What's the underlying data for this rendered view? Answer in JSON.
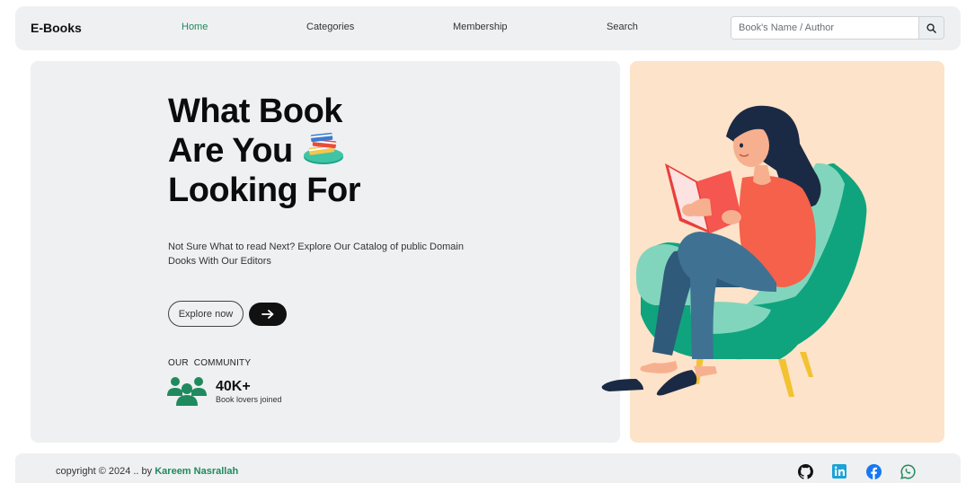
{
  "navbar": {
    "brand": "E-Books",
    "links": [
      "Home",
      "Categories",
      "Membership",
      "Search"
    ],
    "active": "Home",
    "search_placeholder": "Book's Name / Author",
    "search_icon": "search-icon"
  },
  "hero": {
    "title_lines": [
      "What Book",
      "Are You",
      "Looking For"
    ],
    "title_icon": "books-stack-icon",
    "description": "Not Sure What to read Next? Explore Our Catalog of public Domain Dooks With Our Editors",
    "explore_label": "Explore now",
    "arrow_icon": "arrow-right-icon",
    "community_label": "OUR  COMMUNITY",
    "community_count": "40K+",
    "community_sub": "Book lovers joined",
    "community_icon": "users-group-icon",
    "illustration": "woman-reading-in-armchair"
  },
  "footer": {
    "copyright_prefix": "copyright © 2024 .. by ",
    "author": "Kareem Nasrallah",
    "social": [
      "github-icon",
      "linkedin-icon",
      "facebook-icon",
      "whatsapp-icon"
    ]
  },
  "colors": {
    "accent": "#1f8a5e",
    "panel_gray": "#eef0f1",
    "panel_peach": "#fde3c9",
    "dark": "#111111"
  }
}
